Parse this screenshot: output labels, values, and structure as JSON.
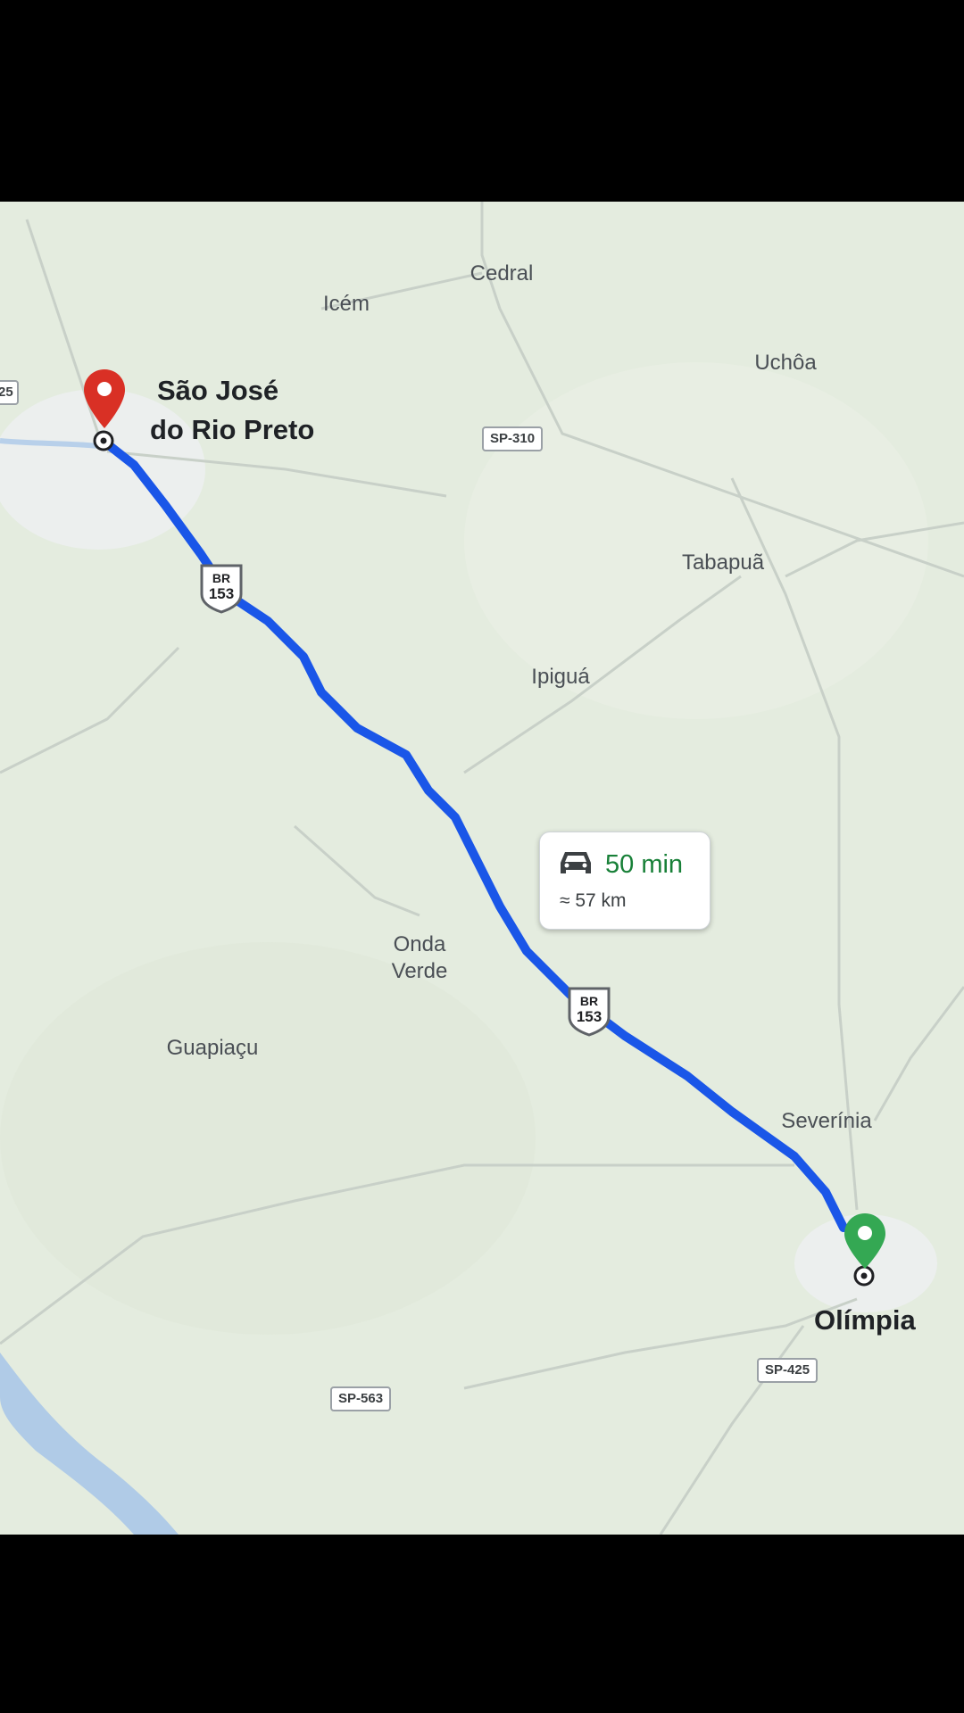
{
  "map": {
    "origin": {
      "label_line1": "São José",
      "label_line2": "do Rio Preto",
      "icon": "red-location-pin-icon",
      "color": "#d93025"
    },
    "destination": {
      "label": "Olímpia",
      "icon": "green-location-pin-icon",
      "color": "#34a853"
    },
    "route": {
      "duration": "50 min",
      "distance": "≈ 57 km",
      "mode_icon": "car-icon",
      "route_color": "#1a56e8"
    },
    "places": {
      "cedral": "Cedral",
      "icem": "Icém",
      "uchoa": "Uchôa",
      "tabapua": "Tabapuã",
      "ipigua": "Ipiguá",
      "onda_verde_line1": "Onda",
      "onda_verde_line2": "Verde",
      "guapiacu": "Guapiaçu",
      "severinia": "Severínia"
    },
    "roads": {
      "sp310": "SP-310",
      "sp563": "SP-563",
      "sp425": "SP-425",
      "edge_left": "25",
      "br_prefix": "BR",
      "br_number": "153"
    }
  }
}
